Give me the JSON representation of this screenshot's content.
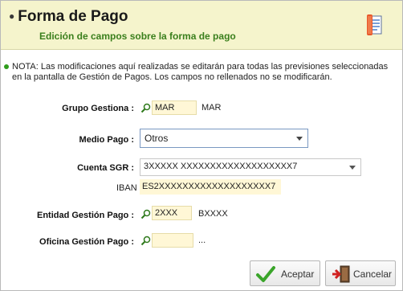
{
  "header": {
    "title": "Forma de Pago",
    "subtitle": "Edición de campos sobre la forma de pago",
    "icon": "form-document-icon"
  },
  "note": "NOTA: Las modificaciones aquí realizadas se editarán para todas las previsiones seleccionadas en la pantalla de Gestión de Pagos. Los campos no rellenados no se modificarán.",
  "fields": {
    "grupo_gestiona": {
      "label": "Grupo Gestiona :",
      "value": "MAR",
      "description": "MAR"
    },
    "medio_pago": {
      "label": "Medio Pago :",
      "value": "Otros"
    },
    "cuenta_sgr": {
      "label": "Cuenta SGR :",
      "value": "3XXXXX XXXXXXXXXXXXXXXXXXX7"
    },
    "iban": {
      "label": "IBAN",
      "value": "ES2XXXXXXXXXXXXXXXXXXX7"
    },
    "entidad_gestion_pago": {
      "label": "Entidad Gestión Pago :",
      "value": "2XXX",
      "description": "BXXXX"
    },
    "oficina_gestion_pago": {
      "label": "Oficina Gestión Pago :",
      "value": "",
      "description": "..."
    }
  },
  "buttons": {
    "accept": "Aceptar",
    "cancel": "Cancelar"
  },
  "colors": {
    "header_bg": "#f5f4cc",
    "subtitle": "#3a7f1c",
    "field_bg": "#fff7d6",
    "combo_border": "#7a98c1"
  }
}
